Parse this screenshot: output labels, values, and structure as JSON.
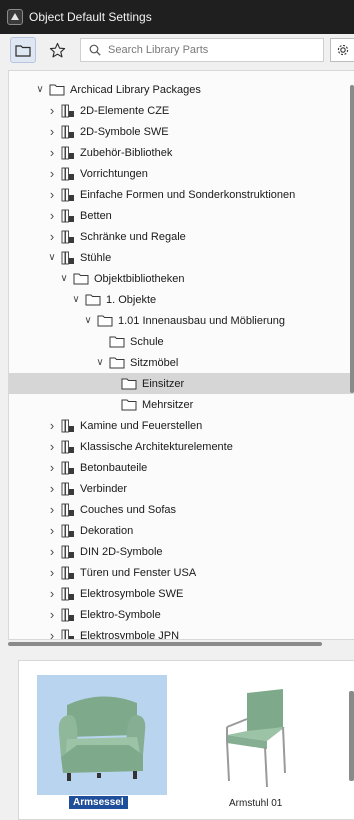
{
  "window": {
    "title": "Object Default Settings"
  },
  "toolbar": {
    "search_placeholder": "Search Library Parts",
    "folder_view_icon": "folder-icon",
    "favorites_icon": "star-icon",
    "settings_icon": "gear-icon"
  },
  "tree": {
    "items": [
      {
        "label": "Archicad Library Packages",
        "level": 0,
        "state": "expanded",
        "icon": "folder-icon"
      },
      {
        "label": "2D-Elemente CZE",
        "level": 1,
        "state": "collapsed",
        "icon": "library-icon"
      },
      {
        "label": "2D-Symbole SWE",
        "level": 1,
        "state": "collapsed",
        "icon": "library-icon"
      },
      {
        "label": "Zubehör-Bibliothek",
        "level": 1,
        "state": "collapsed",
        "icon": "library-icon"
      },
      {
        "label": "Vorrichtungen",
        "level": 1,
        "state": "collapsed",
        "icon": "library-icon"
      },
      {
        "label": "Einfache Formen und Sonderkonstruktionen",
        "level": 1,
        "state": "collapsed",
        "icon": "library-icon"
      },
      {
        "label": "Betten",
        "level": 1,
        "state": "collapsed",
        "icon": "library-icon"
      },
      {
        "label": "Schränke und Regale",
        "level": 1,
        "state": "collapsed",
        "icon": "library-icon"
      },
      {
        "label": "Stühle",
        "level": 1,
        "state": "expanded",
        "icon": "library-icon"
      },
      {
        "label": "Objektbibliotheken",
        "level": 2,
        "state": "expanded",
        "icon": "folder-icon"
      },
      {
        "label": "1. Objekte",
        "level": 3,
        "state": "expanded",
        "icon": "folder-icon"
      },
      {
        "label": "1.01 Innenausbau und Möblierung",
        "level": 4,
        "state": "expanded",
        "icon": "folder-icon"
      },
      {
        "label": "Schule",
        "level": 5,
        "state": "leaf",
        "icon": "folder-icon"
      },
      {
        "label": "Sitzmöbel",
        "level": 5,
        "state": "expanded",
        "icon": "folder-icon"
      },
      {
        "label": "Einsitzer",
        "level": 6,
        "state": "leaf",
        "icon": "folder-icon",
        "selected": true
      },
      {
        "label": "Mehrsitzer",
        "level": 6,
        "state": "leaf",
        "icon": "folder-icon"
      },
      {
        "label": "Kamine und Feuerstellen",
        "level": 1,
        "state": "collapsed",
        "icon": "library-icon"
      },
      {
        "label": "Klassische Architekturelemente",
        "level": 1,
        "state": "collapsed",
        "icon": "library-icon"
      },
      {
        "label": "Betonbauteile",
        "level": 1,
        "state": "collapsed",
        "icon": "library-icon"
      },
      {
        "label": "Verbinder",
        "level": 1,
        "state": "collapsed",
        "icon": "library-icon"
      },
      {
        "label": "Couches und Sofas",
        "level": 1,
        "state": "collapsed",
        "icon": "library-icon"
      },
      {
        "label": "Dekoration",
        "level": 1,
        "state": "collapsed",
        "icon": "library-icon"
      },
      {
        "label": "DIN 2D-Symbole",
        "level": 1,
        "state": "collapsed",
        "icon": "library-icon"
      },
      {
        "label": "Türen und Fenster USA",
        "level": 1,
        "state": "collapsed",
        "icon": "library-icon"
      },
      {
        "label": "Elektrosymbole SWE",
        "level": 1,
        "state": "collapsed",
        "icon": "library-icon"
      },
      {
        "label": "Elektro-Symbole",
        "level": 1,
        "state": "collapsed",
        "icon": "library-icon"
      },
      {
        "label": "Elektrosymbole JPN",
        "level": 1,
        "state": "collapsed",
        "icon": "library-icon"
      }
    ]
  },
  "preview": {
    "items": [
      {
        "label": "Armsessel",
        "selected": true,
        "icon": "armchair-icon"
      },
      {
        "label": "Armstuhl 01",
        "selected": false,
        "icon": "chair-icon"
      }
    ]
  },
  "colors": {
    "titlebar": "#1f1f1f",
    "selection_row": "#d6d6d6",
    "selection_tile": "#b9d4ee",
    "selection_caption": "#1f4f9a",
    "chair_green": "#8fb79a"
  }
}
